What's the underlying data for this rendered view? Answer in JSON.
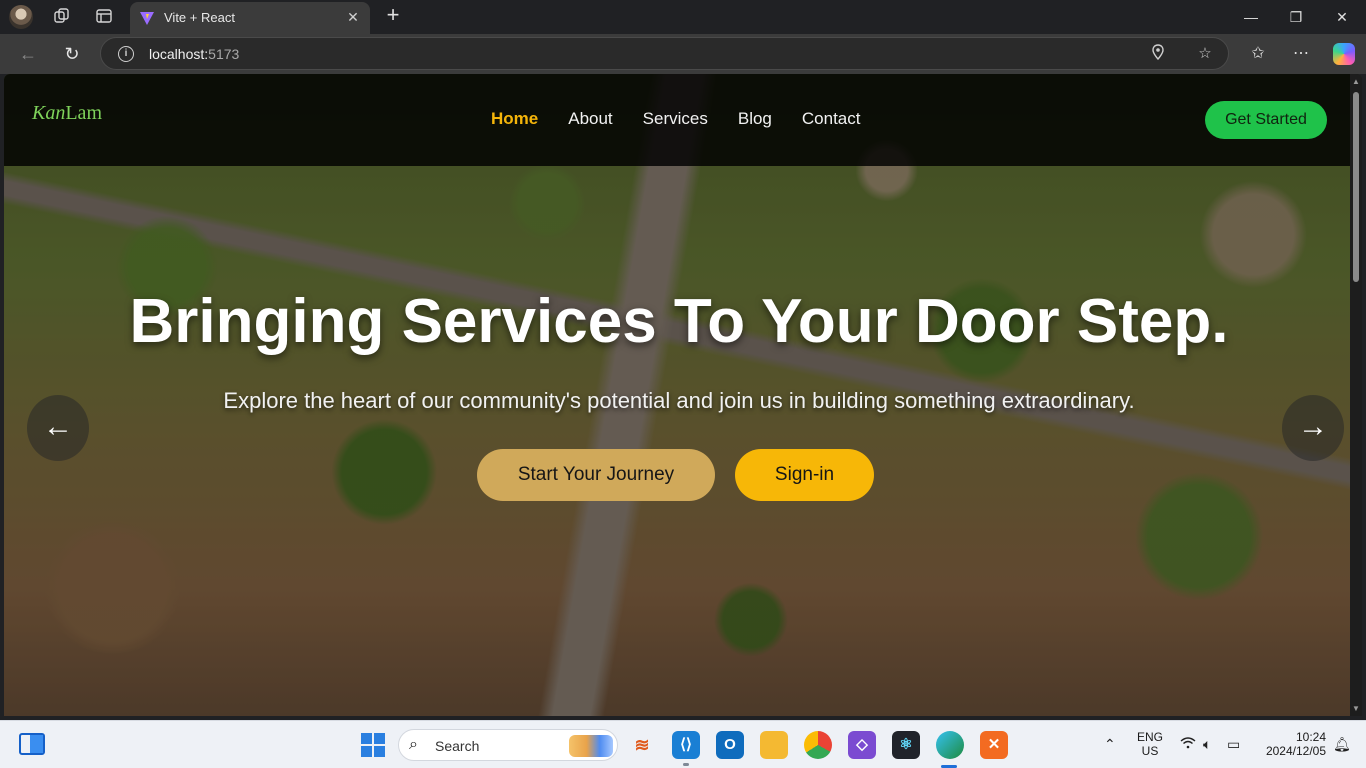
{
  "browser": {
    "tab_title": "Vite + React",
    "url_host": "localhost:",
    "url_port": "5173",
    "icons": [
      "profile-avatar",
      "workspaces-icon",
      "tab-actions-icon",
      "vite-favicon",
      "close-icon",
      "plus-icon",
      "minimize-icon",
      "restore-icon",
      "close-window-icon",
      "back-icon",
      "refresh-icon",
      "info-icon",
      "location-icon",
      "star-icon",
      "favorites-icon",
      "more-icon",
      "copilot-icon"
    ]
  },
  "site": {
    "logo_script": "Kan",
    "logo_text": "Lam",
    "nav": [
      {
        "label": "Home",
        "active": true
      },
      {
        "label": "About",
        "active": false
      },
      {
        "label": "Services",
        "active": false
      },
      {
        "label": "Blog",
        "active": false
      },
      {
        "label": "Contact",
        "active": false
      }
    ],
    "cta_label": "Get Started",
    "hero": {
      "headline": "Bringing Services To Your Door Step.",
      "subhead": "Explore the heart of our community's potential and join us in building something extraordinary.",
      "primary_button": "Start Your Journey",
      "secondary_button": "Sign-in",
      "prev_arrow": "←",
      "next_arrow": "→"
    },
    "colors": {
      "active_nav": "#f5b50a",
      "cta": "#1fc24a",
      "journey_button": "#d0a95a",
      "signin_button": "#f7b707",
      "logo": "#7fd35a"
    }
  },
  "taskbar": {
    "search_label": "Search",
    "language": "ENG",
    "region": "US",
    "time": "10:24",
    "date": "2024/12/05",
    "apps": [
      "outlook-lines-app",
      "vscode-app",
      "outlook-app",
      "file-explorer-app",
      "chrome-app",
      "visual-studio-app",
      "react-devtools-app",
      "edge-app",
      "xampp-app"
    ]
  }
}
